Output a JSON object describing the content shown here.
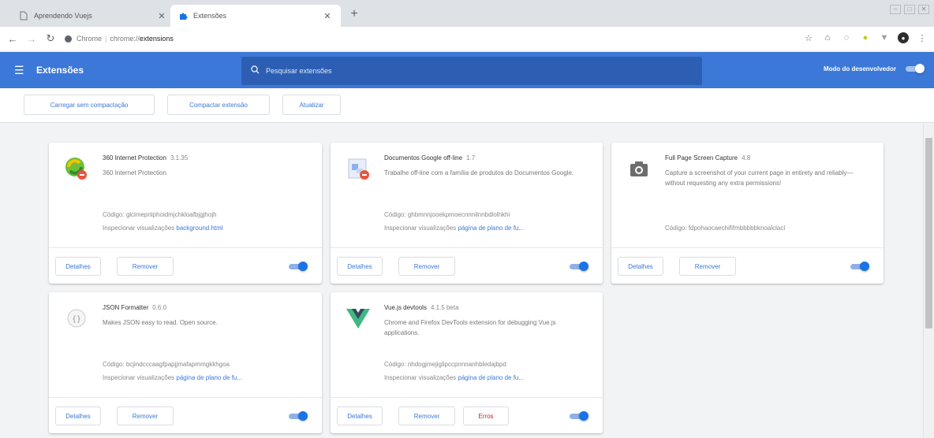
{
  "tabs": [
    {
      "title": "Aprendendo Vuejs",
      "icon": "page-icon",
      "active": false
    },
    {
      "title": "Extensões",
      "icon": "puzzle-icon",
      "active": true
    }
  ],
  "toolbar": {
    "site_label": "Chrome",
    "url_scheme": "chrome://",
    "url_path": "extensions"
  },
  "header": {
    "title": "Extensões",
    "search_placeholder": "Pesquisar extensões",
    "dev_mode_label": "Modo do desenvolvedor",
    "dev_mode_on": true
  },
  "dev_toolbar": {
    "load_unpacked": "Carregar sem compactação",
    "pack": "Compactar extensão",
    "update": "Atualizar"
  },
  "cards": [
    {
      "name": "360 Internet Protection",
      "version": "3.1.35",
      "description": "360 Internet Protection",
      "id_label": "Código:",
      "id": "glcimepnlphoidmjchkloafbjgjhojh",
      "inspect_label": "Inspecionar visualizações",
      "inspect_link": "background.html",
      "details": "Detalhes",
      "remove": "Remover",
      "enabled": true,
      "icon": "360-protection-icon"
    },
    {
      "name": "Documentos Google off-line",
      "version": "1.7",
      "description": "Trabalhe off-line com a família de produtos do Documentos Google.",
      "id_label": "Código:",
      "id": "ghbmnnjooekpmoecnnnilnnbdlolhkhi",
      "inspect_label": "Inspecionar visualizações",
      "inspect_link": "página de plano de fu...",
      "details": "Detalhes",
      "remove": "Remover",
      "enabled": true,
      "icon": "google-docs-offline-icon"
    },
    {
      "name": "Full Page Screen Capture",
      "version": "4.8",
      "description": "Capture a screenshot of your current page in entirety and reliably—without requesting any extra permissions!",
      "id_label": "Código:",
      "id": "fdpohaocaechififmbbbbbknoalclacl",
      "inspect_label": "",
      "inspect_link": "",
      "details": "Detalhes",
      "remove": "Remover",
      "enabled": true,
      "icon": "camera-icon"
    },
    {
      "name": "JSON Formatter",
      "version": "0.6.0",
      "description": "Makes JSON easy to read. Open source.",
      "id_label": "Código:",
      "id": "bcjindcccaagfpapjjmafapmmgkkhgoa",
      "inspect_label": "Inspecionar visualizações",
      "inspect_link": "página de plano de fu...",
      "details": "Detalhes",
      "remove": "Remover",
      "enabled": true,
      "icon": "json-braces-icon"
    },
    {
      "name": "Vue.js devtools",
      "version": "4.1.5 beta",
      "description": "Chrome and Firefox DevTools extension for debugging Vue.js applications.",
      "id_label": "Código:",
      "id": "nhdogjmejiglipccpnnnanhbledajbpd",
      "inspect_label": "Inspecionar visualizações",
      "inspect_link": "página de plano de fu...",
      "details": "Detalhes",
      "remove": "Remover",
      "errors": "Erros",
      "enabled": true,
      "icon": "vue-logo-icon"
    }
  ]
}
